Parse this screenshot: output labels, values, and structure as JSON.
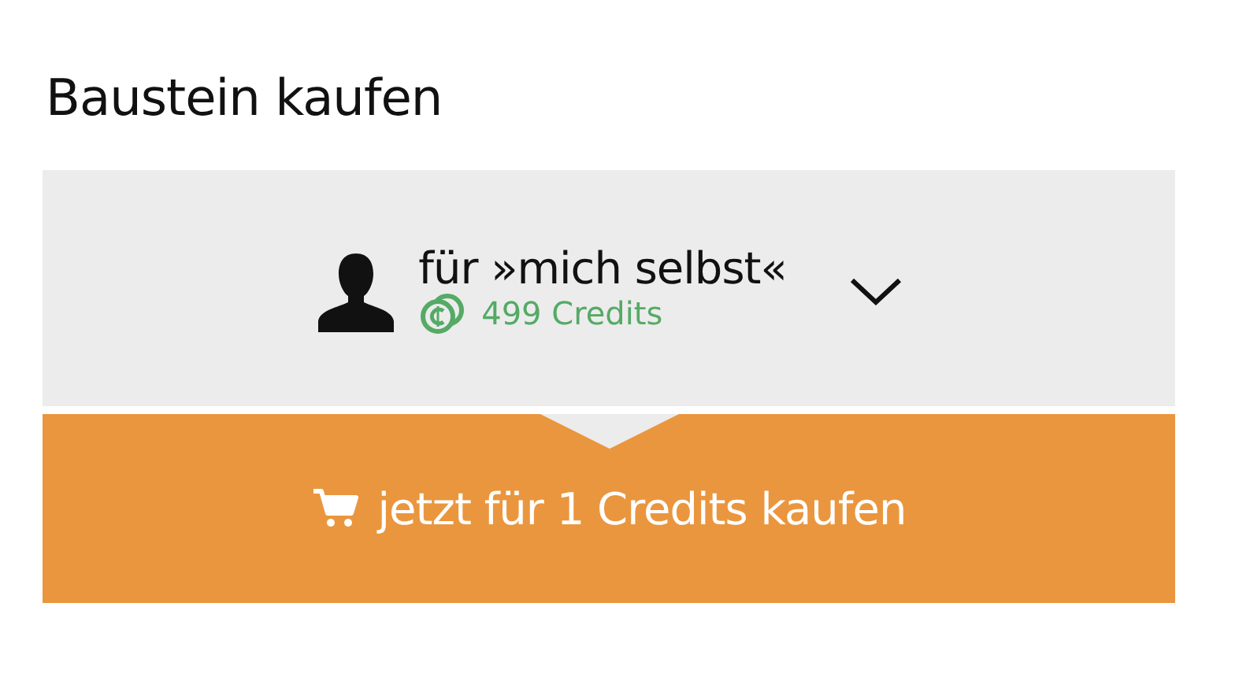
{
  "title": "Baustein kaufen",
  "recipient": {
    "label": "für »mich selbst«",
    "credits": "499 Credits"
  },
  "buy_button": {
    "label": "jetzt für 1 Credits kaufen"
  }
}
